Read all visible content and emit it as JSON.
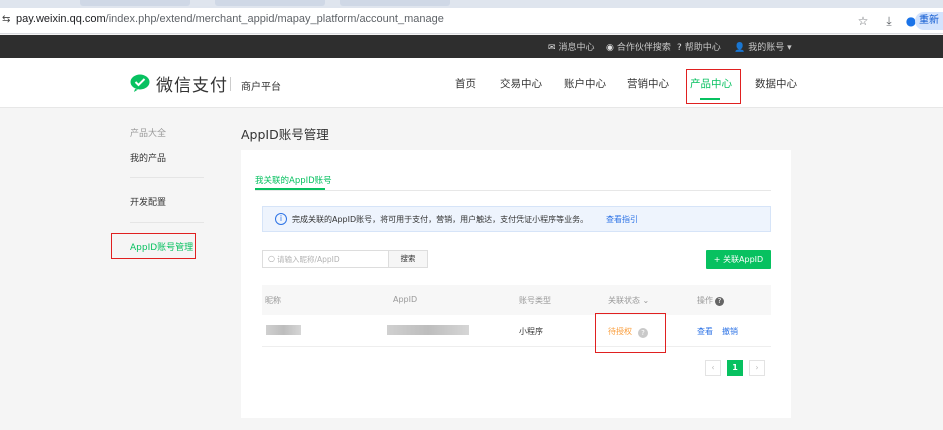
{
  "browser": {
    "site_icon": "site-settings-icon",
    "url_domain": "pay.weixin.qq.com",
    "url_path": "/index.php/extend/merchant_appid/mapay_platform/account_manage",
    "actions": [
      "star-icon",
      "download-icon",
      "profile-icon"
    ],
    "reload_label": "重新"
  },
  "topnav": {
    "messages": "消息中心",
    "partners": "合作伙伴搜索",
    "help": "帮助中心",
    "account": "我的账号"
  },
  "header": {
    "logo_text": "微信支付",
    "platform": "商户平台",
    "nav": [
      "首页",
      "交易中心",
      "账户中心",
      "营销中心",
      "产品中心",
      "数据中心"
    ],
    "active_nav": "产品中心",
    "colors": {
      "accent": "#07c160",
      "highlight_box": "#e02020"
    }
  },
  "sidebar": {
    "group_title": "产品大全",
    "items": [
      "我的产品",
      "开发配置",
      "AppID账号管理"
    ],
    "active_item": "AppID账号管理"
  },
  "main": {
    "title": "AppID账号管理",
    "tab": "我关联的AppID账号",
    "notice_text": "完成关联的AppID账号，将可用于支付，营销，用户触达，支付凭证小程序等业务。",
    "notice_link": "查看指引",
    "search_placeholder": "请输入昵称/AppID",
    "search_button": "搜索",
    "add_button": "+ 关联AppID",
    "table": {
      "columns": [
        "昵称",
        "AppID",
        "账号类型",
        "关联状态",
        "操作"
      ],
      "rows": [
        {
          "nickname": "",
          "appid": "",
          "type": "小程序",
          "status": "待授权",
          "actions": [
            "查看",
            "撤销"
          ]
        }
      ]
    },
    "pagination": {
      "current_page": "1",
      "prev": "‹",
      "next": "›"
    }
  }
}
